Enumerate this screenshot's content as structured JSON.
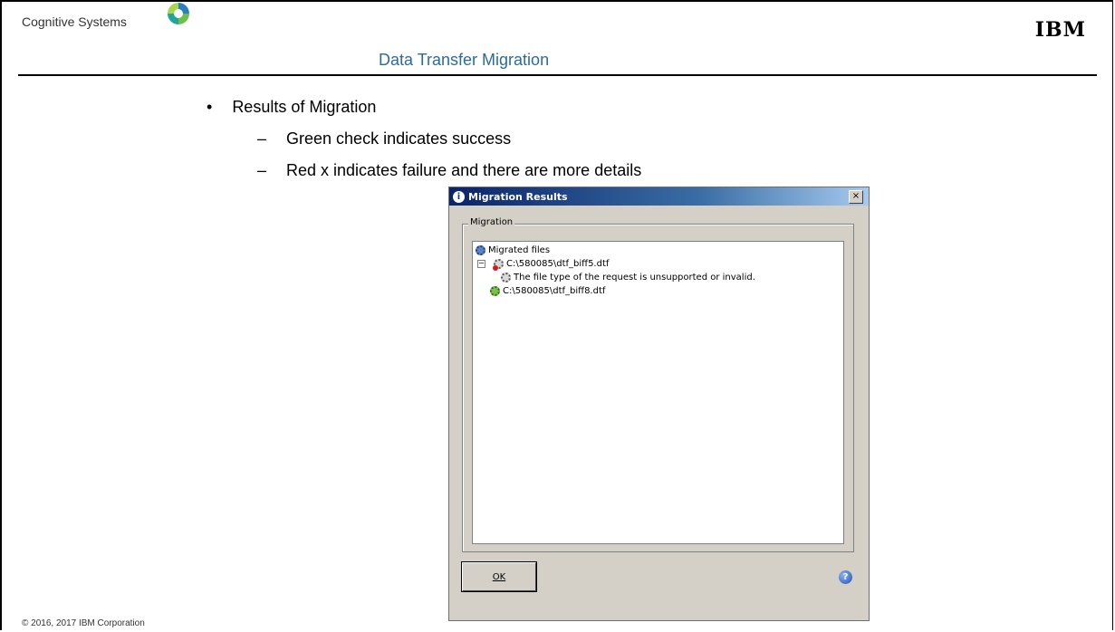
{
  "slide": {
    "brand": "Cognitive Systems",
    "title": "Data Transfer Migration",
    "ibm_logo": "IBM",
    "footer": "© 2016, 2017 IBM Corporation",
    "bullet_main": "Results of Migration",
    "sub_bullets": [
      "Green check indicates success",
      "Red x indicates failure and there are more details"
    ]
  },
  "dialog": {
    "title": "Migration Results",
    "close_glyph": "×",
    "group_label": "Migration",
    "tree": {
      "root": "Migrated files",
      "items": [
        {
          "path": "C:\\580085\\dtf_biff5.dtf",
          "status": "error",
          "expander": "−"
        },
        {
          "message": "The file type of the request is unsupported or invalid.",
          "status": "info"
        },
        {
          "path": "C:\\580085\\dtf_biff8.dtf",
          "status": "success"
        }
      ]
    },
    "ok_label": "OK",
    "help_glyph": "?"
  },
  "colors": {
    "title": "#2c6b9e",
    "dialog_bg": "#d4d0c8",
    "error": "#d21c1c",
    "success": "#7bc04a"
  },
  "icons": {
    "logo": "cognitive-systems-logo",
    "info": "info-icon",
    "help": "help-icon",
    "gear": "gear-icon"
  }
}
